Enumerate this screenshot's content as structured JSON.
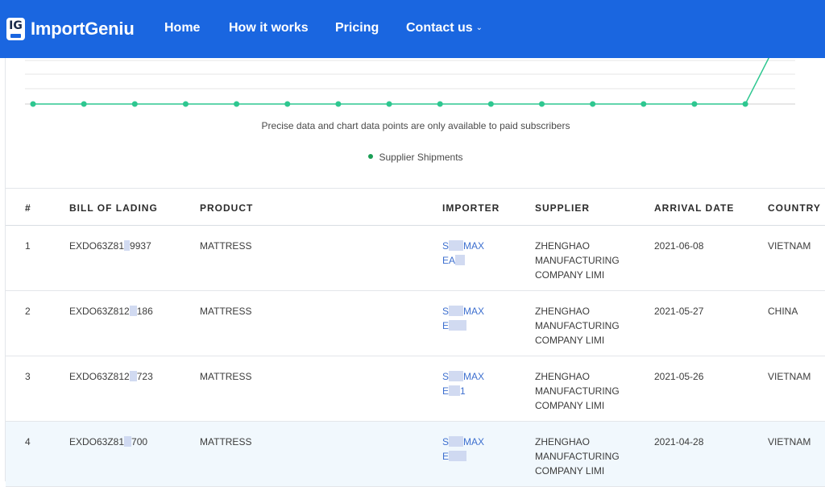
{
  "brand": {
    "badge": "IG",
    "name": "ImportGeniu"
  },
  "nav": {
    "home": "Home",
    "how_it_works": "How it works",
    "pricing": "Pricing",
    "contact": "Contact us",
    "contact_chevron": "⌄"
  },
  "chart": {
    "note": "Precise data and chart data points are only available to paid subscribers",
    "legend_label": "Supplier Shipments",
    "series_color": "#2ec790",
    "legend_color": "#1a9e55"
  },
  "chart_data": {
    "type": "line",
    "title": "",
    "xlabel": "",
    "ylabel": "",
    "grid": true,
    "legend": "bottom-center",
    "series": [
      {
        "name": "Supplier Shipments",
        "values": [
          0,
          0,
          0,
          0,
          0,
          0,
          0,
          0,
          0,
          0,
          0,
          0,
          0,
          0,
          0,
          4
        ]
      }
    ]
  },
  "table": {
    "headers": [
      "#",
      "BILL OF LADING",
      "PRODUCT",
      "IMPORTER",
      "SUPPLIER",
      "ARRIVAL DATE",
      "COUNTRY"
    ],
    "rows": [
      {
        "num": "1",
        "bol_a": "EXDO63Z81",
        "bol_b": "9937",
        "product": "MATTRESS",
        "imp_a1": "S",
        "imp_a2": "MAX",
        "imp_b1": "EA",
        "imp_b2": "",
        "supplier_1": "ZHENGHAO",
        "supplier_2": "MANUFACTURING",
        "supplier_3": "COMPANY LIMI",
        "date": "2021-06-08",
        "country": "VIETNAM"
      },
      {
        "num": "2",
        "bol_a": "EXDO63Z812",
        "bol_b": "186",
        "product": "MATTRESS",
        "imp_a1": "S",
        "imp_a2": "MAX",
        "imp_b1": "E",
        "imp_b2": "",
        "supplier_1": "ZHENGHAO",
        "supplier_2": "MANUFACTURING",
        "supplier_3": "COMPANY LIMI",
        "date": "2021-05-27",
        "country": "CHINA"
      },
      {
        "num": "3",
        "bol_a": "EXDO63Z812",
        "bol_b": "723",
        "product": "MATTRESS",
        "imp_a1": "S",
        "imp_a2": "MAX",
        "imp_b1": "E",
        "imp_b2": "1",
        "supplier_1": "ZHENGHAO",
        "supplier_2": "MANUFACTURING",
        "supplier_3": "COMPANY LIMI",
        "date": "2021-05-26",
        "country": "VIETNAM"
      },
      {
        "num": "4",
        "bol_a": "EXDO63Z81",
        "bol_b": "700",
        "product": "MATTRESS",
        "imp_a1": "S",
        "imp_a2": "MAX",
        "imp_b1": "E",
        "imp_b2": "",
        "supplier_1": "ZHENGHAO",
        "supplier_2": "MANUFACTURING",
        "supplier_3": "COMPANY LIMI",
        "date": "2021-04-28",
        "country": "VIETNAM"
      }
    ]
  }
}
